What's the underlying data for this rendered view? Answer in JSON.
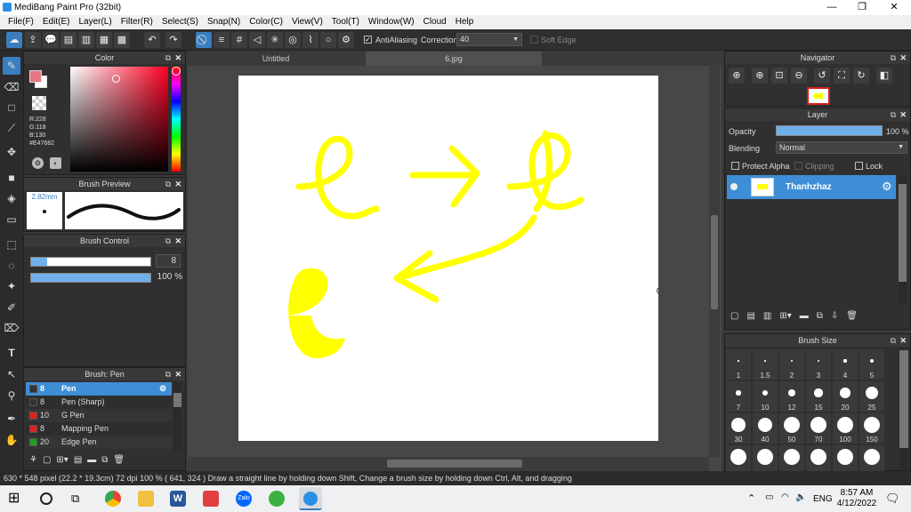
{
  "window": {
    "title": "MediBang Paint Pro (32bit)",
    "minimize": "—",
    "maximize": "❐",
    "close": "✕"
  },
  "menu": [
    "File(F)",
    "Edit(E)",
    "Layer(L)",
    "Filter(R)",
    "Select(S)",
    "Snap(N)",
    "Color(C)",
    "View(V)",
    "Tool(T)",
    "Window(W)",
    "Cloud",
    "Help"
  ],
  "toolbar": {
    "antialiasing": "AntiAliasing",
    "correction_label": "Correction",
    "correction_value": "40",
    "soft_edge": "Soft Edge"
  },
  "color_panel": {
    "title": "Color",
    "r": "R:228",
    "g": "G:118",
    "b": "B:130",
    "hex": "#E47682",
    "primary": "#e47682"
  },
  "brush_preview": {
    "title": "Brush Preview",
    "size": "2.82mm"
  },
  "brush_control": {
    "title": "Brush Control",
    "size_value": "8",
    "opacity_value": "100 %"
  },
  "brush_list": {
    "title": "Brush: Pen",
    "items": [
      {
        "size": "8",
        "name": "Pen",
        "color": "#333333",
        "selected": true
      },
      {
        "size": "8",
        "name": "Pen (Sharp)",
        "color": "#333333",
        "selected": false
      },
      {
        "size": "10",
        "name": "G Pen",
        "color": "#e02020",
        "selected": false
      },
      {
        "size": "8",
        "name": "Mapping Pen",
        "color": "#e02020",
        "selected": false
      },
      {
        "size": "20",
        "name": "Edge Pen",
        "color": "#20a020",
        "selected": false
      }
    ]
  },
  "tabs": [
    "Untitled",
    "6.jpg"
  ],
  "navigator": {
    "title": "Navigator"
  },
  "layer_panel": {
    "title": "Layer",
    "opacity_label": "Opacity",
    "opacity_value": "100 %",
    "blending_label": "Blending",
    "blending_value": "Normal",
    "protect_alpha": "Protect Alpha",
    "clipping": "Clipping",
    "lock": "Lock",
    "layer_name": "Thanhzhaz"
  },
  "brush_size": {
    "title": "Brush Size",
    "sizes": [
      "1",
      "1.5",
      "2",
      "3",
      "4",
      "5",
      "7",
      "10",
      "12",
      "15",
      "20",
      "25",
      "30",
      "40",
      "50",
      "70",
      "100",
      "150",
      "",
      "",
      "",
      "",
      "",
      ""
    ]
  },
  "status": {
    "text": "630 * 548 pixel   (22.2 * 19.3cm)   72 dpi   100 %   ( 641, 324 )   Draw a straight line by holding down Shift, Change a brush size by holding down Ctrl, Alt, and dragging"
  },
  "taskbar": {
    "lang": "ENG",
    "time": "8:57 AM",
    "date": "4/12/2022"
  },
  "stroke_color": "#ffff00"
}
